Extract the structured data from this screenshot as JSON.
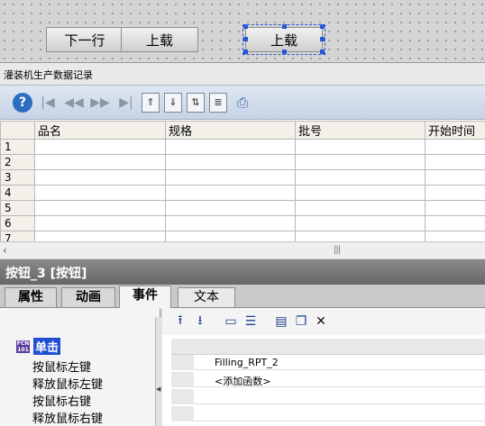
{
  "canvas": {
    "buttons": [
      {
        "label": "下一行"
      },
      {
        "label": "上载"
      },
      {
        "label": "上载",
        "selected": true
      }
    ]
  },
  "table_control": {
    "title": "灌装机生产数据记录",
    "toolbar_icons": [
      "help-icon",
      "first-icon",
      "prev-page-icon",
      "next-page-icon",
      "last-icon",
      "move-up-icon",
      "move-down-icon",
      "sort-icon",
      "export-icon",
      "print-icon"
    ],
    "columns": [
      "品名",
      "规格",
      "批号",
      "开始时间"
    ],
    "row_numbers": [
      "1",
      "2",
      "3",
      "4",
      "5",
      "6",
      "7"
    ]
  },
  "properties_panel": {
    "title": "按钮_3 [按钮]",
    "tabs": [
      "属性",
      "动画",
      "事件",
      "文本"
    ],
    "active_tab": "事件",
    "event_tree": {
      "root": "单击",
      "items": [
        "按鼠标左键",
        "释放鼠标左键",
        "按鼠标右键",
        "释放鼠标右键"
      ]
    },
    "function_list": [
      "Filling_RPT_2",
      "<添加函数>"
    ],
    "toolbar_icons": [
      "move-up-icon",
      "move-down-icon",
      "folder-icon",
      "list-icon",
      "script-icon",
      "copy-icon",
      "delete-icon"
    ]
  },
  "colors": {
    "selection_blue": "#2a56d6",
    "tree_highlight": "#1f4fd1",
    "panel_header": "#777777"
  }
}
